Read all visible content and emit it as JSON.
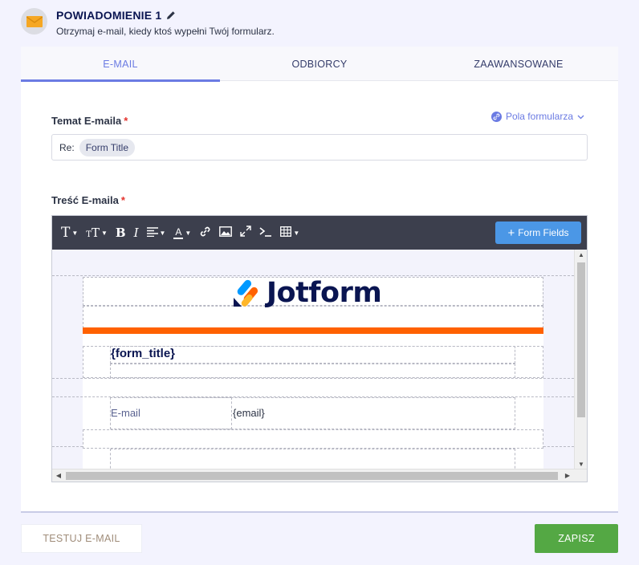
{
  "header": {
    "title": "POWIADOMIENIE 1",
    "subtitle": "Otrzymaj e-mail, kiedy ktoś wypełni Twój formularz.",
    "icon": "envelope-icon"
  },
  "tabs": [
    {
      "label": "E-MAIL",
      "active": true
    },
    {
      "label": "ODBIORCY",
      "active": false
    },
    {
      "label": "ZAAWANSOWANE",
      "active": false
    }
  ],
  "subject": {
    "label": "Temat E-maila",
    "required_mark": "*",
    "prefix": "Re:",
    "chip": "Form Title",
    "form_fields_link": "Pola formularza"
  },
  "body": {
    "label": "Treść E-maila",
    "required_mark": "*",
    "toolbar": {
      "form_fields_button": "Form Fields"
    },
    "content": {
      "logo_text": "Jotform",
      "form_title_placeholder": "{form_title}",
      "field_label": "E-mail",
      "field_value": "{email}"
    }
  },
  "footer": {
    "test_label": "TESTUJ E-MAIL",
    "save_label": "ZAPISZ"
  },
  "colors": {
    "accent": "#6b7be3",
    "brand_orange": "#ff6100",
    "save_green": "#54a844",
    "toolbar": "#3c3f4d",
    "form_fields_blue": "#4b97e6"
  }
}
